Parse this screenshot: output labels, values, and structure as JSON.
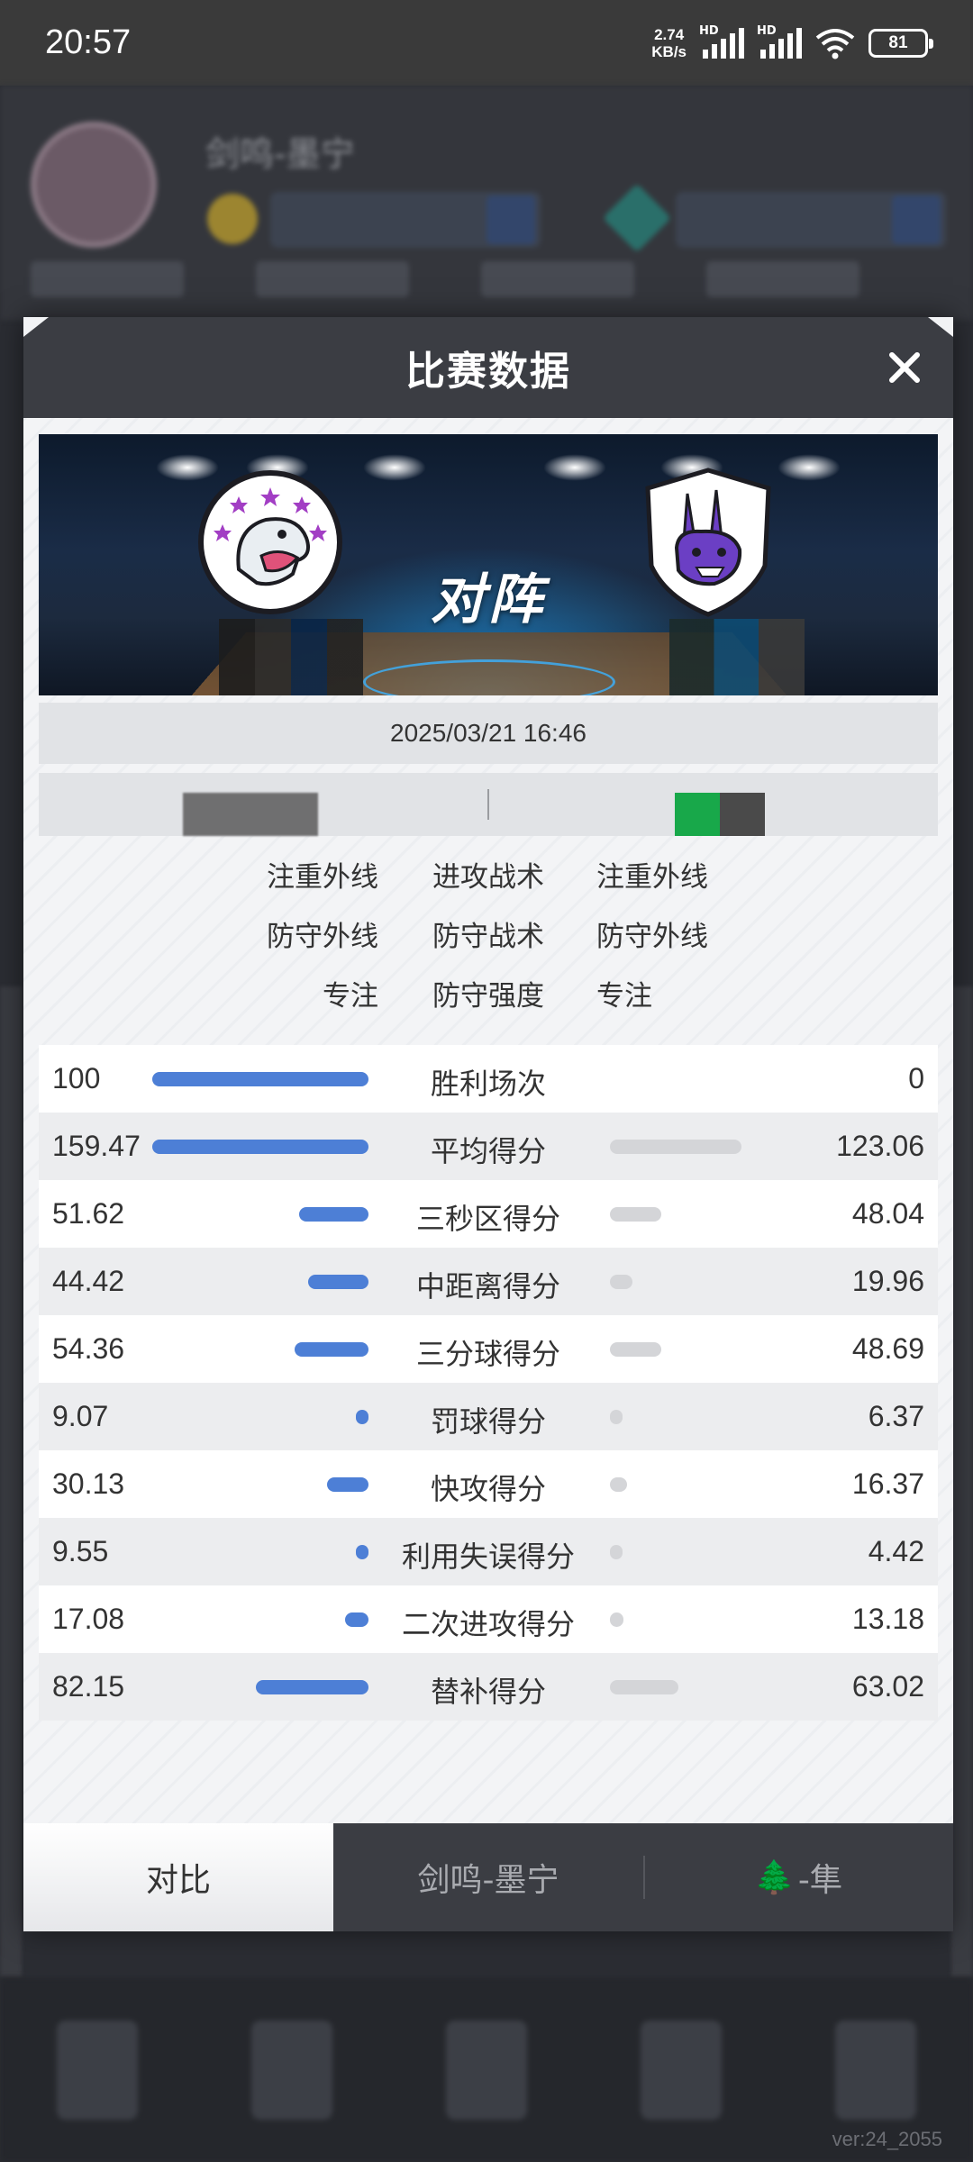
{
  "status_bar": {
    "time": "20:57",
    "net_speed_value": "2.74",
    "net_speed_unit": "KB/s",
    "signal1_label": "HD",
    "signal2_label": "HD",
    "battery": "81"
  },
  "modal": {
    "title": "比赛数据",
    "date": "2025/03/21 16:46",
    "vs_label": "对阵",
    "tactics": [
      {
        "left": "注重外线",
        "mid": "进攻战术",
        "right": "注重外线"
      },
      {
        "left": "防守外线",
        "mid": "防守战术",
        "right": "防守外线"
      },
      {
        "left": "专注",
        "mid": "防守强度",
        "right": "专注"
      }
    ],
    "stats": [
      {
        "label": "胜利场次",
        "left": "100",
        "right": "0",
        "left_fill": 1.0,
        "right_fill": 0.0
      },
      {
        "label": "平均得分",
        "left": "159.47",
        "right": "123.06",
        "left_fill": 1.0,
        "right_fill": 0.77
      },
      {
        "label": "三秒区得分",
        "left": "51.62",
        "right": "48.04",
        "left_fill": 0.32,
        "right_fill": 0.3
      },
      {
        "label": "中距离得分",
        "left": "44.42",
        "right": "19.96",
        "left_fill": 0.28,
        "right_fill": 0.13
      },
      {
        "label": "三分球得分",
        "left": "54.36",
        "right": "48.69",
        "left_fill": 0.34,
        "right_fill": 0.3
      },
      {
        "label": "罚球得分",
        "left": "9.07",
        "right": "6.37",
        "left_fill": 0.06,
        "right_fill": 0.04
      },
      {
        "label": "快攻得分",
        "left": "30.13",
        "right": "16.37",
        "left_fill": 0.19,
        "right_fill": 0.1
      },
      {
        "label": "利用失误得分",
        "left": "9.55",
        "right": "4.42",
        "left_fill": 0.06,
        "right_fill": 0.03
      },
      {
        "label": "二次进攻得分",
        "left": "17.08",
        "right": "13.18",
        "left_fill": 0.11,
        "right_fill": 0.08
      },
      {
        "label": "替补得分",
        "left": "82.15",
        "right": "63.02",
        "left_fill": 0.52,
        "right_fill": 0.4
      }
    ],
    "tabs": [
      {
        "label": "对比",
        "active": true
      },
      {
        "label": "剑鸣-墨宁",
        "active": false
      },
      {
        "label": "-隼",
        "prefix_icon": "tree-emoji",
        "active": false
      }
    ],
    "colors": {
      "left_bar": "#4d7fd6",
      "right_bar": "#d4d5d8",
      "header": "#3b3d43"
    }
  },
  "background": {
    "player_name": "剑鸣-墨宁",
    "version": "ver:24_2055"
  }
}
